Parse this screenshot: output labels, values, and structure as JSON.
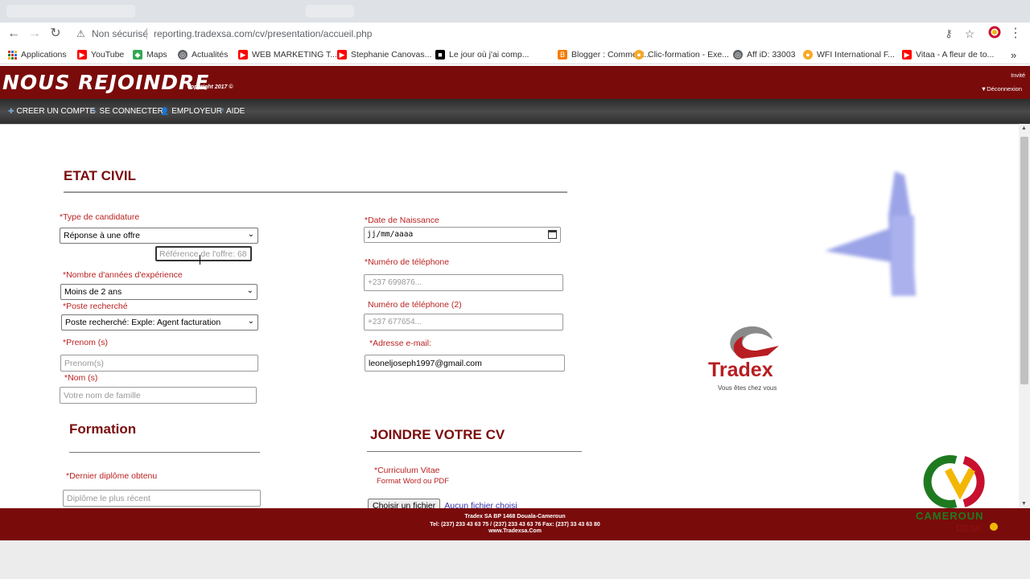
{
  "browser": {
    "security_label": "Non sécurisé",
    "url": "reporting.tradexsa.com/cv/presentation/accueil.php",
    "bookmarks": [
      {
        "label": "Applications",
        "color": "#d93025"
      },
      {
        "label": "YouTube",
        "color": "#ff0000"
      },
      {
        "label": "Maps",
        "color": "#34a853"
      },
      {
        "label": "Actualités",
        "color": "#5f6368"
      },
      {
        "label": "WEB MARKETING T...",
        "color": "#ff0000"
      },
      {
        "label": "Stephanie Canovas...",
        "color": "#ff0000"
      },
      {
        "label": "Le jour où j'ai comp...",
        "color": "#000000"
      },
      {
        "label": "Blogger : Comment...",
        "color": "#f57c00"
      },
      {
        "label": "Clic-formation - Exe...",
        "color": "#f9a825"
      },
      {
        "label": "Aff iD: 33003",
        "color": "#5f6368"
      },
      {
        "label": "WFI International F...",
        "color": "#f9a825"
      },
      {
        "label": "Vitaa - A fleur de to...",
        "color": "#ff0000"
      }
    ],
    "more": "»"
  },
  "header": {
    "title": "NOUS REJOINDRE",
    "copyright": "copyright 2017 ©",
    "guest": "Invité",
    "logout": "▼Déconnexion"
  },
  "nav": [
    {
      "icon": "✚",
      "label": "CREER UN COMPTE"
    },
    {
      "icon": "✎",
      "label": "SE CONNECTER"
    },
    {
      "icon": "👤",
      "label": "EMPLOYEUR"
    },
    {
      "icon": "?",
      "label": "AIDE"
    }
  ],
  "etat_civil": {
    "heading": "ETAT CIVIL",
    "type_label": "*Type de candidature",
    "type_value": "Réponse à une offre",
    "ref_placeholder": "Référence de l'offre: 68",
    "experience_label": "*Nombre d'années d'expérience",
    "experience_value": "Moins de 2 ans",
    "poste_label": "*Poste recherché",
    "poste_value": "Poste recherché: Exple: Agent facturation",
    "prenom_label": "*Prenom (s)",
    "prenom_placeholder": "Prenom(s)",
    "nom_label": "*Nom (s)",
    "nom_placeholder": "Votre nom de famille",
    "dob_label": "*Date de Naissance",
    "dob_value": "jj/mm/aaaa",
    "phone_label": "*Numéro de téléphone",
    "phone_placeholder": "+237 699876...",
    "phone2_label": "Numéro de téléphone (2)",
    "phone2_placeholder": "+237 677654...",
    "email_label": "*Adresse e-mail:",
    "email_value": "leoneljoseph1997@gmail.com"
  },
  "formation": {
    "heading": "Formation",
    "diplome_label": "*Dernier diplôme obtenu",
    "diplome_placeholder": "Diplôme le plus récent"
  },
  "cv": {
    "heading": "JOINDRE VOTRE CV",
    "cv_label": "*Curriculum Vitae",
    "cv_hint": "Format Word ou PDF",
    "file_button": "Choisir un fichier",
    "file_status": "Aucun fichier choisi"
  },
  "brand": {
    "name": "Tradex",
    "tagline": "Vous êtes chez vous",
    "watermark": "CAMEROUN",
    "watermark2": "DESK"
  },
  "footer": {
    "line1": "Tradex SA  BP 1468 Douala-Cameroun",
    "line2": "Tel: (237) 233 43 63 75 / (237) 233 43 63 76   Fax: (237) 33 43 63 80",
    "line3": "www.Tradexsa.Com"
  }
}
